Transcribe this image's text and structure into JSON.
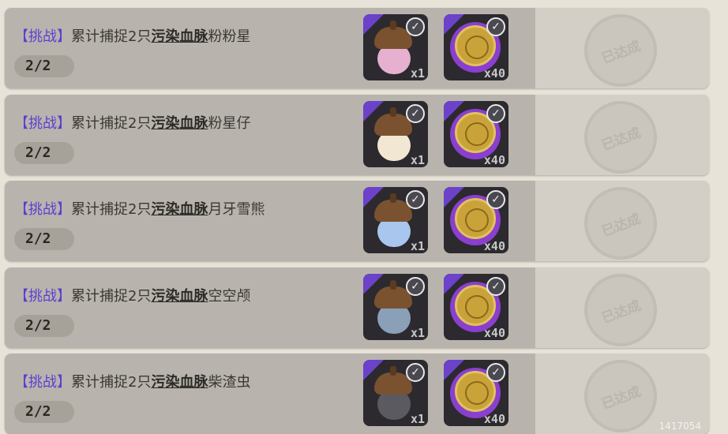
{
  "tasks": [
    {
      "tag": "【挑战】",
      "prefix": "累计捕捉2只",
      "keyword": "污染血脉",
      "target": "粉粉星",
      "progress": "2/2",
      "rewards": [
        {
          "count": "x1"
        },
        {
          "count": "x40"
        }
      ],
      "acorn_color": "#e6b0d1",
      "stamp_text": "已达成"
    },
    {
      "tag": "【挑战】",
      "prefix": "累计捕捉2只",
      "keyword": "污染血脉",
      "target": "粉星仔",
      "progress": "2/2",
      "rewards": [
        {
          "count": "x1"
        },
        {
          "count": "x40"
        }
      ],
      "acorn_color": "#f1e7d2",
      "stamp_text": "已达成"
    },
    {
      "tag": "【挑战】",
      "prefix": "累计捕捉2只",
      "keyword": "污染血脉",
      "target": "月牙雪熊",
      "progress": "2/2",
      "rewards": [
        {
          "count": "x1"
        },
        {
          "count": "x40"
        }
      ],
      "acorn_color": "#a8c6ee",
      "stamp_text": "已达成"
    },
    {
      "tag": "【挑战】",
      "prefix": "累计捕捉2只",
      "keyword": "污染血脉",
      "target": "空空颅",
      "progress": "2/2",
      "rewards": [
        {
          "count": "x1"
        },
        {
          "count": "x40"
        }
      ],
      "acorn_color": "#8aa0b8",
      "stamp_text": "已达成"
    },
    {
      "tag": "【挑战】",
      "prefix": "累计捕捉2只",
      "keyword": "污染血脉",
      "target": "柴渣虫",
      "progress": "2/2",
      "rewards": [
        {
          "count": "x1"
        },
        {
          "count": "x40"
        }
      ],
      "acorn_color": "#5a5a60",
      "stamp_text": "已达成"
    }
  ],
  "watermark": "1417054",
  "icons": {
    "reward_1": "acorn-capsule-icon",
    "reward_2": "gold-coin-icon",
    "claimed": "checkmark-icon",
    "completed": "completed-stamp-icon"
  },
  "colors": {
    "tag": "#5b3fd1",
    "row_bg": "#b8b4ad",
    "page_bg": "#e8e3d9",
    "reward_corner": "#6b42c9"
  }
}
